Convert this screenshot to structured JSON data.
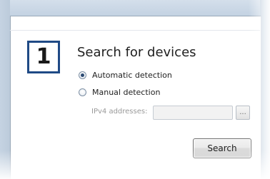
{
  "step": {
    "number": "1",
    "title": "Search for devices"
  },
  "detection": {
    "options": [
      {
        "label": "Automatic detection",
        "selected": true
      },
      {
        "label": "Manual detection",
        "selected": false
      }
    ]
  },
  "manual": {
    "ipv4_label": "IPv4 addresses:",
    "ipv4_value": "",
    "browse_label": "..."
  },
  "actions": {
    "search_label": "Search"
  },
  "colors": {
    "step_border": "#1f4a85",
    "radio_dot": "#2b4a72",
    "disabled_text": "#9a9a9a"
  }
}
